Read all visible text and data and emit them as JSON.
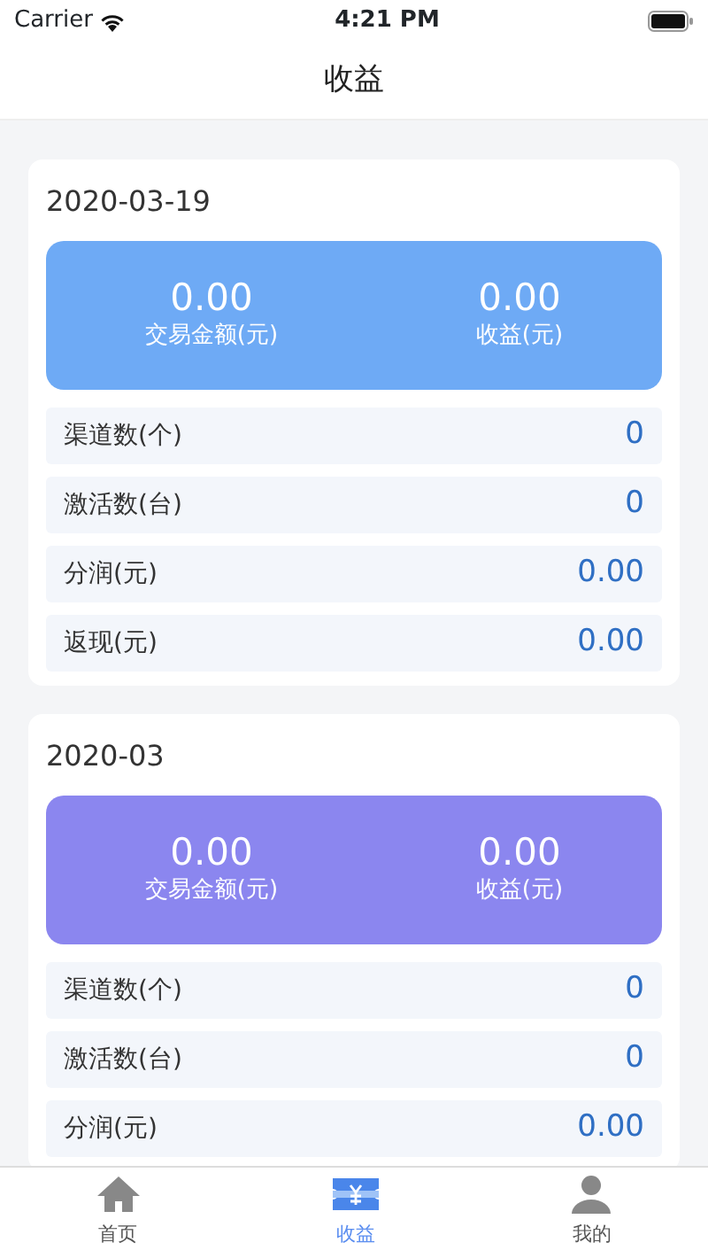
{
  "status_bar": {
    "carrier": "Carrier",
    "time": "4:21 PM"
  },
  "title": "收益",
  "sections": [
    {
      "date": "2020-03-19",
      "color": "#6eaaf5",
      "summary": [
        {
          "value": "0.00",
          "label": "交易金额(元)"
        },
        {
          "value": "0.00",
          "label": "收益(元)"
        }
      ],
      "rows": [
        {
          "label": "渠道数(个)",
          "value": "0"
        },
        {
          "label": "激活数(台)",
          "value": "0"
        },
        {
          "label": "分润(元)",
          "value": "0.00"
        },
        {
          "label": "返现(元)",
          "value": "0.00"
        }
      ]
    },
    {
      "date": "2020-03",
      "color": "#8b86ef",
      "summary": [
        {
          "value": "0.00",
          "label": "交易金额(元)"
        },
        {
          "value": "0.00",
          "label": "收益(元)"
        }
      ],
      "rows": [
        {
          "label": "渠道数(个)",
          "value": "0"
        },
        {
          "label": "激活数(台)",
          "value": "0"
        },
        {
          "label": "分润(元)",
          "value": "0.00"
        }
      ]
    }
  ],
  "tabs": [
    {
      "label": "首页",
      "kind": "home",
      "selected": false
    },
    {
      "label": "收益",
      "kind": "income",
      "selected": true
    },
    {
      "label": "我的",
      "kind": "profile",
      "selected": false
    }
  ]
}
